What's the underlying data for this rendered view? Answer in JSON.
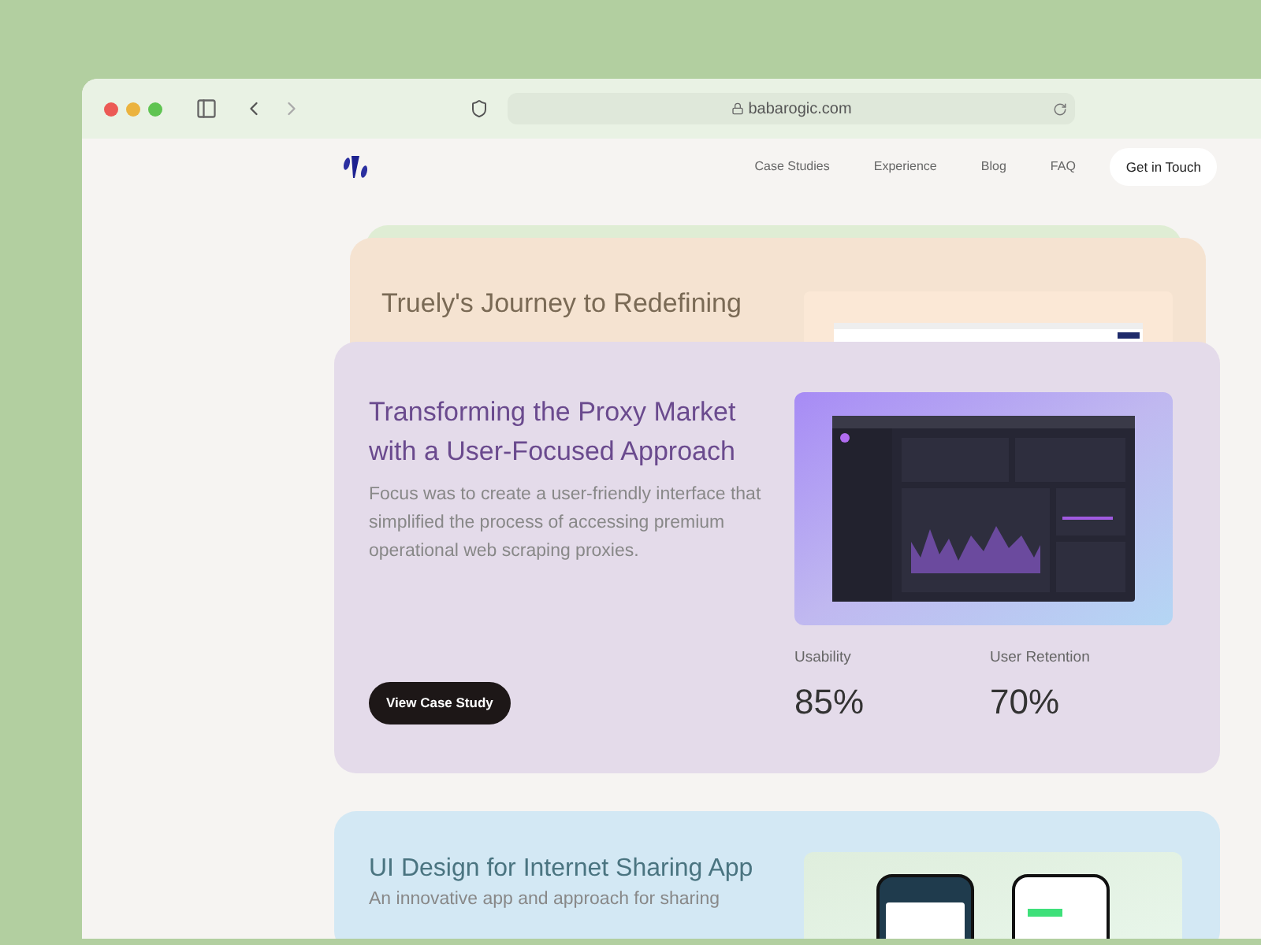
{
  "browser": {
    "url": "babarogic.com"
  },
  "nav": {
    "links": [
      "Case Studies",
      "Experience",
      "Blog",
      "FAQ"
    ],
    "cta": "Get in Touch"
  },
  "cards": [
    {
      "title": "Truely's Journey to Redefining"
    },
    {
      "title": "Transforming the Proxy Market with a User-Focused Approach",
      "description": "Focus was to create a user-friendly interface that simplified the process of accessing premium operational web scraping proxies.",
      "button": "View Case Study",
      "stats": [
        {
          "label": "Usability",
          "value": "85%"
        },
        {
          "label": "User Retention",
          "value": "70%"
        }
      ]
    },
    {
      "title": "UI Design for Internet Sharing App",
      "description": "An innovative app and approach for sharing"
    }
  ]
}
